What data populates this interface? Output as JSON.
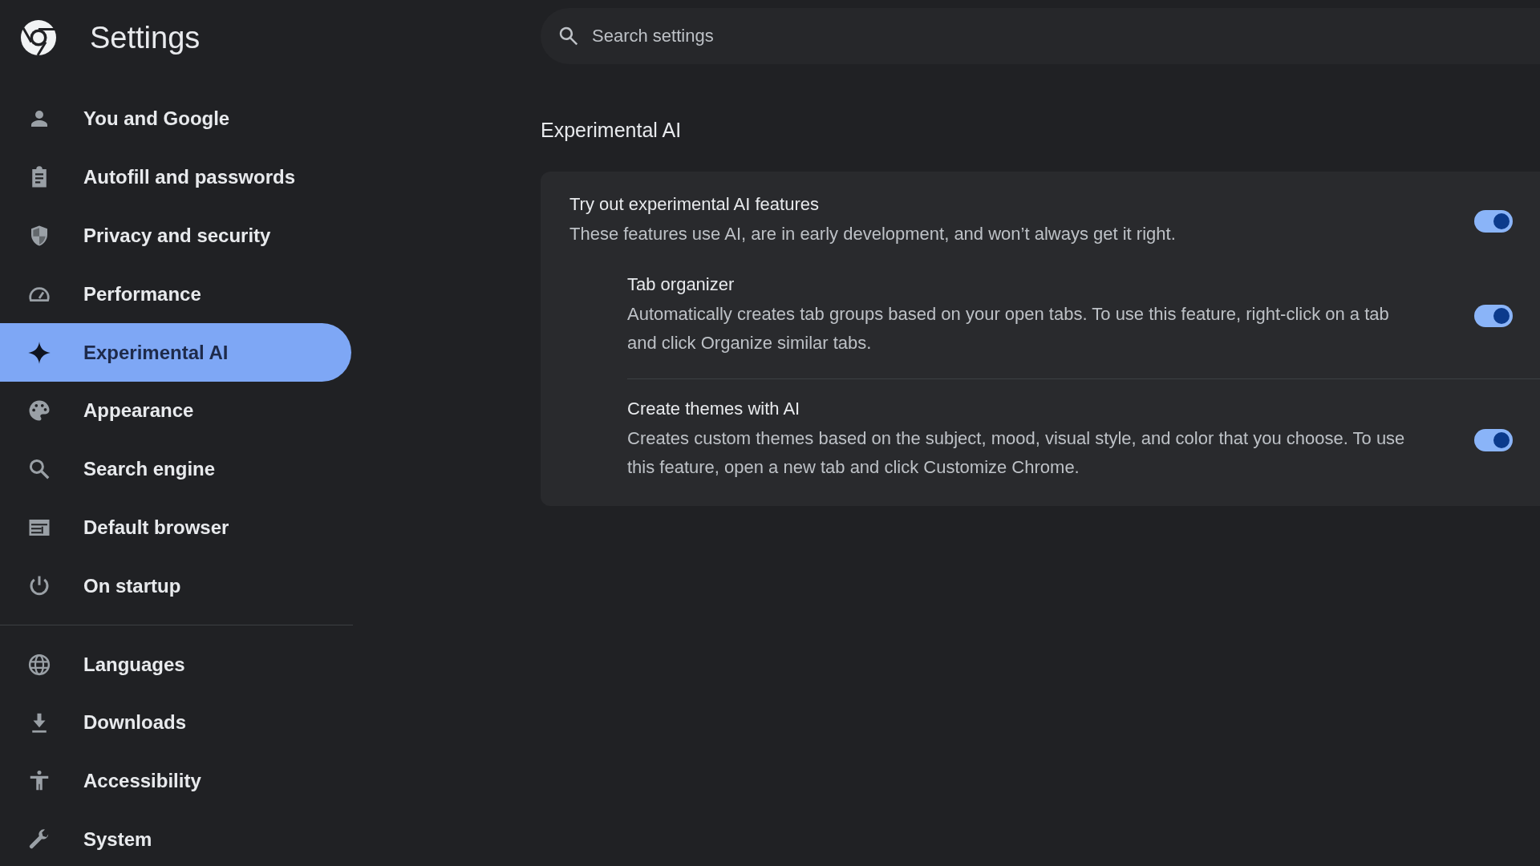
{
  "header": {
    "title": "Settings"
  },
  "search": {
    "placeholder": "Search settings"
  },
  "sidebar": {
    "sections": [
      {
        "items": [
          {
            "label": "You and Google",
            "selected": false
          },
          {
            "label": "Autofill and passwords",
            "selected": false
          },
          {
            "label": "Privacy and security",
            "selected": false
          },
          {
            "label": "Performance",
            "selected": false
          },
          {
            "label": "Experimental AI",
            "selected": true
          },
          {
            "label": "Appearance",
            "selected": false
          },
          {
            "label": "Search engine",
            "selected": false
          },
          {
            "label": "Default browser",
            "selected": false
          },
          {
            "label": "On startup",
            "selected": false
          }
        ]
      },
      {
        "items": [
          {
            "label": "Languages",
            "selected": false
          },
          {
            "label": "Downloads",
            "selected": false
          },
          {
            "label": "Accessibility",
            "selected": false
          },
          {
            "label": "System",
            "selected": false
          }
        ]
      }
    ]
  },
  "section": {
    "title": "Experimental AI",
    "settings": [
      {
        "title": "Try out experimental AI features",
        "description": "These features use AI, are in early development, and won’t always get it right.",
        "on": true,
        "children": [
          {
            "title": "Tab organizer",
            "description": "Automatically creates tab groups based on your open tabs. To use this feature, right-click on a tab and click Organize similar tabs.",
            "on": true
          },
          {
            "title": "Create themes with AI",
            "description": "Creates custom themes based on the subject, mood, visual style, and color that you choose. To use this feature, open a new tab and click Customize Chrome.",
            "on": true
          }
        ]
      }
    ]
  }
}
